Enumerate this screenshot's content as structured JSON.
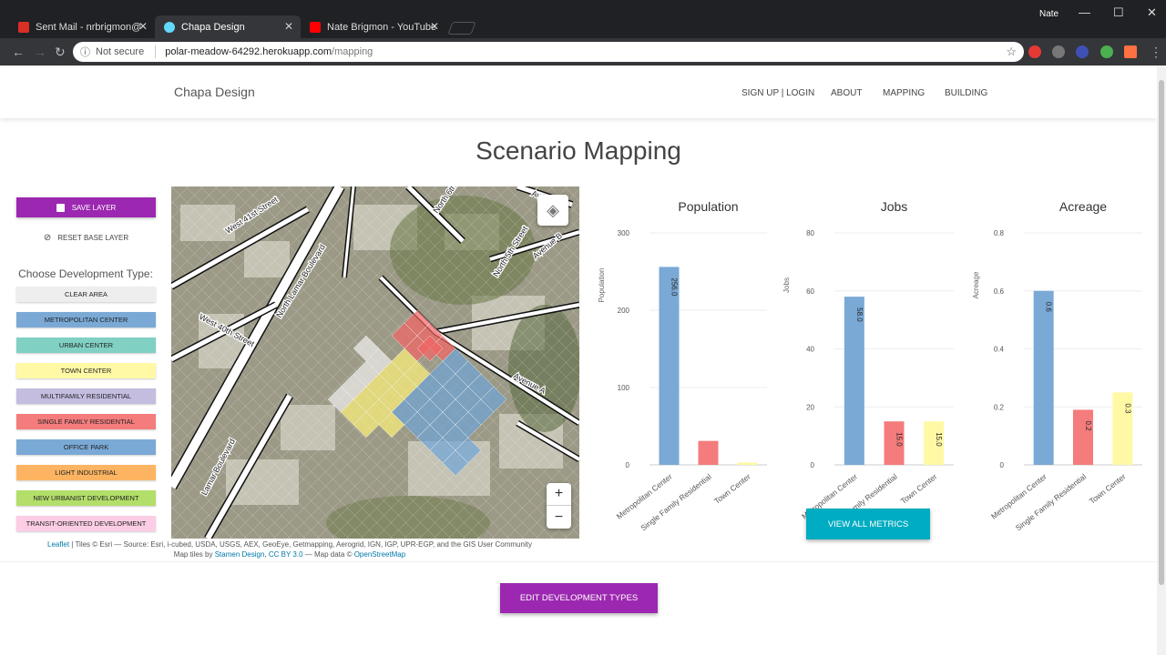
{
  "browser": {
    "tabs": [
      {
        "title": "Sent Mail - nrbrigmon@",
        "favicon_color": "#d93025"
      },
      {
        "title": "Chapa Design",
        "favicon_color": "#61dafb"
      },
      {
        "title": "Nate Brigmon - YouTube",
        "favicon_color": "#ff0000"
      }
    ],
    "user": "Nate",
    "security": "Not secure",
    "url_host": "polar-meadow-64292.herokuapp.com",
    "url_path": "/mapping"
  },
  "site": {
    "brand": "Chapa Design",
    "nav": [
      "SIGN UP | LOGIN",
      "ABOUT",
      "MAPPING",
      "BUILDING"
    ]
  },
  "page_title": "Scenario Mapping",
  "sidebar": {
    "save_label": "SAVE LAYER",
    "reset_label": "RESET BASE LAYER",
    "choose_label": "Choose Development Type:",
    "dev_types": [
      {
        "label": "CLEAR AREA",
        "color": "#eeeeee"
      },
      {
        "label": "METROPOLITAN CENTER",
        "color": "#7aa9d6"
      },
      {
        "label": "URBAN CENTER",
        "color": "#80d0c3"
      },
      {
        "label": "TOWN CENTER",
        "color": "#fff9a6"
      },
      {
        "label": "MULTIFAMILY RESIDENTIAL",
        "color": "#c4bde0"
      },
      {
        "label": "SINGLE FAMILY RESIDENTIAL",
        "color": "#f47c7c"
      },
      {
        "label": "OFFICE PARK",
        "color": "#7aa9d6"
      },
      {
        "label": "LIGHT INDUSTRIAL",
        "color": "#fdb462"
      },
      {
        "label": "NEW URBANIST DEVELOPMENT",
        "color": "#b3de69"
      },
      {
        "label": "TRANSIT-ORIENTED DEVELOPMENT",
        "color": "#fccde5"
      }
    ]
  },
  "map": {
    "street_labels": [
      "West 41st Street",
      "North Lamar Boulevard",
      "West 40th Street",
      "North 6th Street",
      "North 5th Street",
      "Avenue B",
      "Avenue A",
      "Lamar Boulevard",
      "Avenue"
    ],
    "attribution_lead": "Leaflet",
    "attribution_tiles": "| Tiles © Esri — Source: Esri, i-cubed, USDA, USGS, AEX, GeoEye, Getmapping, Aerogrid, IGN, IGP, UPR-EGP, and the GIS User Community",
    "attribution_map_tiles": "Map tiles by",
    "attribution_stamen": "Stamen Design",
    "attribution_cc": "CC BY 3.0",
    "attribution_mapdata": "— Map data ©",
    "attribution_osm": "OpenStreetMap",
    "zoom_in": "+",
    "zoom_out": "−"
  },
  "chart_data": [
    {
      "type": "bar",
      "title": "Population",
      "ylabel": "Population",
      "categories": [
        "Metropolitan Center",
        "Single Family Residential",
        "Town Center"
      ],
      "values": [
        256,
        31,
        3
      ],
      "data_labels": [
        "256.0",
        "",
        ""
      ],
      "colors": [
        "#7aa9d6",
        "#f47c7c",
        "#fff9a6"
      ],
      "yticks": [
        0,
        100,
        200,
        300
      ],
      "ylim": [
        0,
        300
      ]
    },
    {
      "type": "bar",
      "title": "Jobs",
      "ylabel": "Jobs",
      "categories": [
        "Metropolitan Center",
        "Single Family Residential",
        "Town Center"
      ],
      "values": [
        58,
        15,
        15
      ],
      "data_labels": [
        "58.0",
        "15.0",
        "15.0"
      ],
      "colors": [
        "#7aa9d6",
        "#f47c7c",
        "#fff9a6"
      ],
      "yticks": [
        0,
        20,
        40,
        60,
        80
      ],
      "ylim": [
        0,
        80
      ]
    },
    {
      "type": "bar",
      "title": "Acreage",
      "ylabel": "Acreage",
      "categories": [
        "Metropolitan Center",
        "Single Family Residential",
        "Town Center"
      ],
      "values": [
        0.6,
        0.19,
        0.25
      ],
      "data_labels": [
        "0.6",
        "0.2",
        "0.3"
      ],
      "colors": [
        "#7aa9d6",
        "#f47c7c",
        "#fff9a6"
      ],
      "yticks": [
        0,
        0.2,
        0.4,
        0.6,
        0.8
      ],
      "ylim": [
        0,
        0.8
      ]
    }
  ],
  "buttons": {
    "view_all": "VIEW ALL METRICS",
    "edit_types": "EDIT DEVELOPMENT TYPES"
  }
}
